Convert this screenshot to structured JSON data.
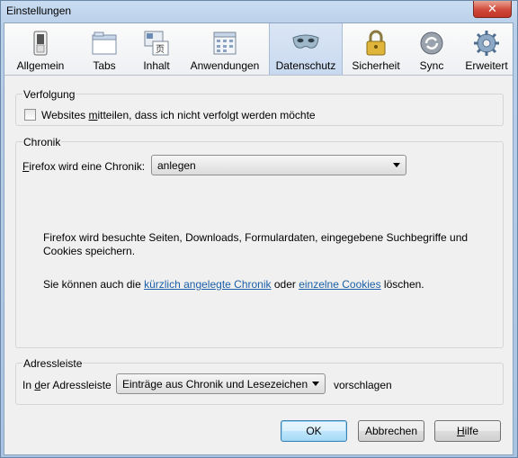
{
  "window": {
    "title": "Einstellungen",
    "close_glyph": "✕"
  },
  "toolbar": {
    "panes": [
      {
        "label": "Allgemein",
        "icon": "switch-icon"
      },
      {
        "label": "Tabs",
        "icon": "tabs-window-icon"
      },
      {
        "label": "Inhalt",
        "icon": "content-icon"
      },
      {
        "label": "Anwendungen",
        "icon": "applications-icon"
      },
      {
        "label": "Datenschutz",
        "icon": "mask-icon",
        "selected": true
      },
      {
        "label": "Sicherheit",
        "icon": "padlock-icon"
      },
      {
        "label": "Sync",
        "icon": "sync-icon"
      },
      {
        "label": "Erweitert",
        "icon": "gear-icon"
      }
    ]
  },
  "tracking": {
    "title": "Verfolgung",
    "checkbox_label_pre": "Websites ",
    "checkbox_label_key": "m",
    "checkbox_label_post": "itteilen, dass ich nicht verfolgt werden möchte",
    "checked": false
  },
  "history": {
    "title": "Chronik",
    "label_key": "F",
    "label_rest": "irefox wird eine Chronik:",
    "selected": "anlegen",
    "info_line1": "Firefox wird besuchte Seiten, Downloads, Formulardaten, eingegebene Suchbegriffe und",
    "info_line2": "Cookies speichern.",
    "links_pre": "Sie können auch die ",
    "link_recent": "kürzlich angelegte Chronik",
    "links_mid": " oder ",
    "link_cookies": "einzelne Cookies",
    "links_post": " löschen."
  },
  "addressbar": {
    "title": "Adressleiste",
    "label_pre": "In ",
    "label_key": "d",
    "label_post": "er Adressleiste",
    "selected": "Einträge aus Chronik und Lesezeichen",
    "suffix": "vorschlagen"
  },
  "buttons": {
    "ok": "OK",
    "cancel": "Abbrechen",
    "help_key": "H",
    "help_rest": "ilfe"
  },
  "colors": {
    "link": "#1c5fa8",
    "selected_pane": "#c8d9ef"
  }
}
